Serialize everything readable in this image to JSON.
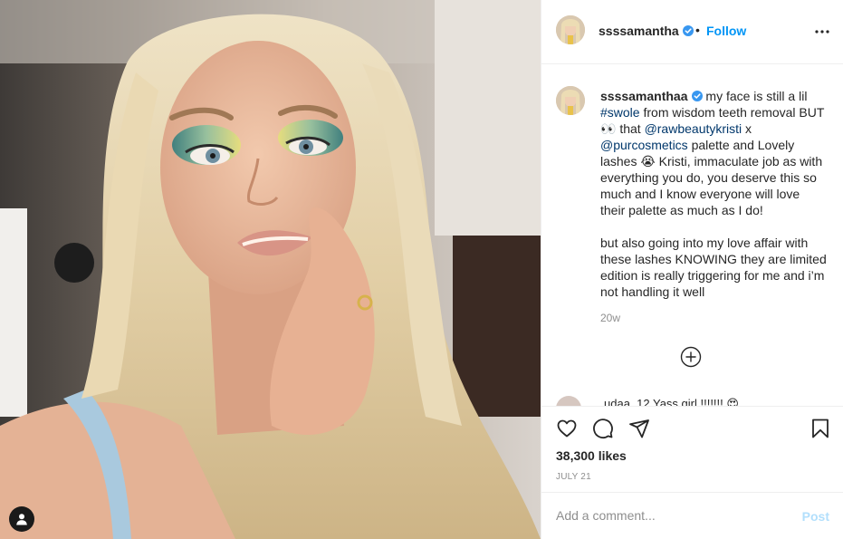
{
  "post": {
    "username": "ssssamantha",
    "verified": true,
    "follow_label": "Follow",
    "separator": "•",
    "menu_icon": "more-horizontal-icon",
    "caption": {
      "segments": [
        {
          "type": "user",
          "text": "ssssamanthaa"
        },
        {
          "type": "text",
          "text": " my face is still a lil "
        },
        {
          "type": "link",
          "text": "#swole"
        },
        {
          "type": "text",
          "text": " from wisdom teeth removal BUT 👀 that "
        },
        {
          "type": "link",
          "text": "@rawbeautykristi"
        },
        {
          "type": "text",
          "text": " x "
        },
        {
          "type": "link",
          "text": "@purcosmetics"
        },
        {
          "type": "text",
          "text": " palette and Lovely lashes 😭 Kristi, immaculate job as with everything you do, you deserve this so much and I know everyone will love their palette as much as I do!\n\nbut also going into my love affair with these lashes KNOWING they are limited edition is really triggering for me and i’m not handling it well"
        }
      ]
    },
    "time_ago": "20w",
    "load_more_icon": "plus-circle-icon",
    "next_comment_partial": "…udaa_12  Yass girl !!!!!!! 😍",
    "likes": "38,300 likes",
    "date": "JULY 21",
    "actions": {
      "like_icon": "heart-icon",
      "comment_icon": "comment-icon",
      "share_icon": "send-icon",
      "save_icon": "bookmark-icon"
    },
    "comment_box": {
      "placeholder": "Add a comment...",
      "post_label": "Post"
    },
    "user_tags_icon": "user-icon",
    "colors": {
      "link": "#00376b",
      "follow": "#0095f6",
      "muted": "#8e8e8e",
      "post_disabled": "#b2dffc",
      "verified": "#3897f0"
    }
  }
}
